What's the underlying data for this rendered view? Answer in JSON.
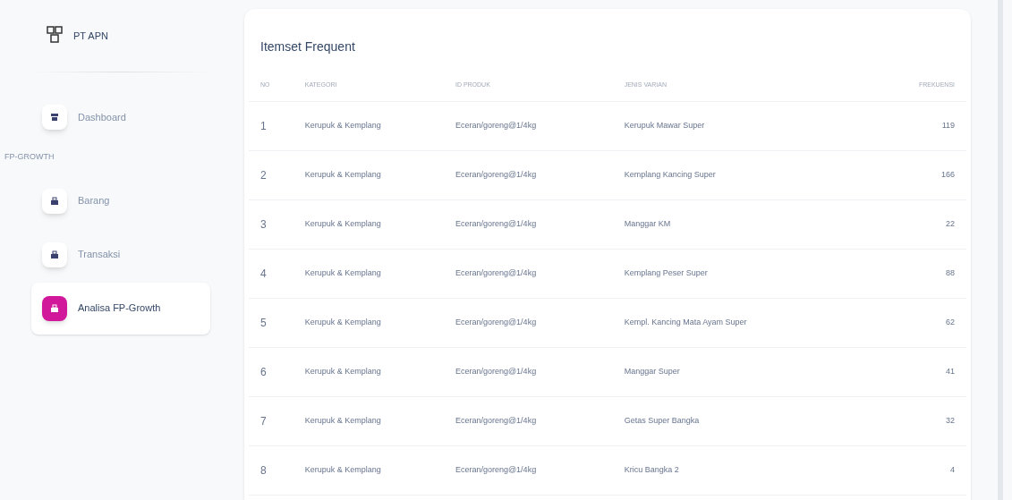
{
  "brand": {
    "name": "PT APN"
  },
  "sidebar": {
    "items": [
      {
        "kind": "link",
        "label": "Dashboard",
        "selected": false
      },
      {
        "kind": "section",
        "label": "FP-GROWTH"
      },
      {
        "kind": "link",
        "label": "Barang",
        "selected": false
      },
      {
        "kind": "link",
        "label": "Transaksi",
        "selected": false
      },
      {
        "kind": "link",
        "label": "Analisa FP-Growth",
        "selected": true
      }
    ]
  },
  "card": {
    "title": "Itemset Frequent"
  },
  "table": {
    "columns": [
      "NO",
      "KATEGORI",
      "ID PRODUK",
      "JENIS VARIAN",
      "FREKUENSI"
    ],
    "rows": [
      [
        "1",
        "Kerupuk & Kemplang",
        "Eceran/goreng@1/4kg",
        "Kerupuk Mawar Super",
        "119"
      ],
      [
        "2",
        "Kerupuk & Kemplang",
        "Eceran/goreng@1/4kg",
        "Kemplang Kancing Super",
        "166"
      ],
      [
        "3",
        "Kerupuk & Kemplang",
        "Eceran/goreng@1/4kg",
        "Manggar KM",
        "22"
      ],
      [
        "4",
        "Kerupuk & Kemplang",
        "Eceran/goreng@1/4kg",
        "Kemplang Peser Super",
        "88"
      ],
      [
        "5",
        "Kerupuk & Kemplang",
        "Eceran/goreng@1/4kg",
        "Kempl. Kancing Mata Ayam Super",
        "62"
      ],
      [
        "6",
        "Kerupuk & Kemplang",
        "Eceran/goreng@1/4kg",
        "Manggar Super",
        "41"
      ],
      [
        "7",
        "Kerupuk & Kemplang",
        "Eceran/goreng@1/4kg",
        "Getas Super Bangka",
        "32"
      ],
      [
        "8",
        "Kerupuk & Kemplang",
        "Eceran/goreng@1/4kg",
        "Kricu Bangka 2",
        "4"
      ]
    ]
  }
}
